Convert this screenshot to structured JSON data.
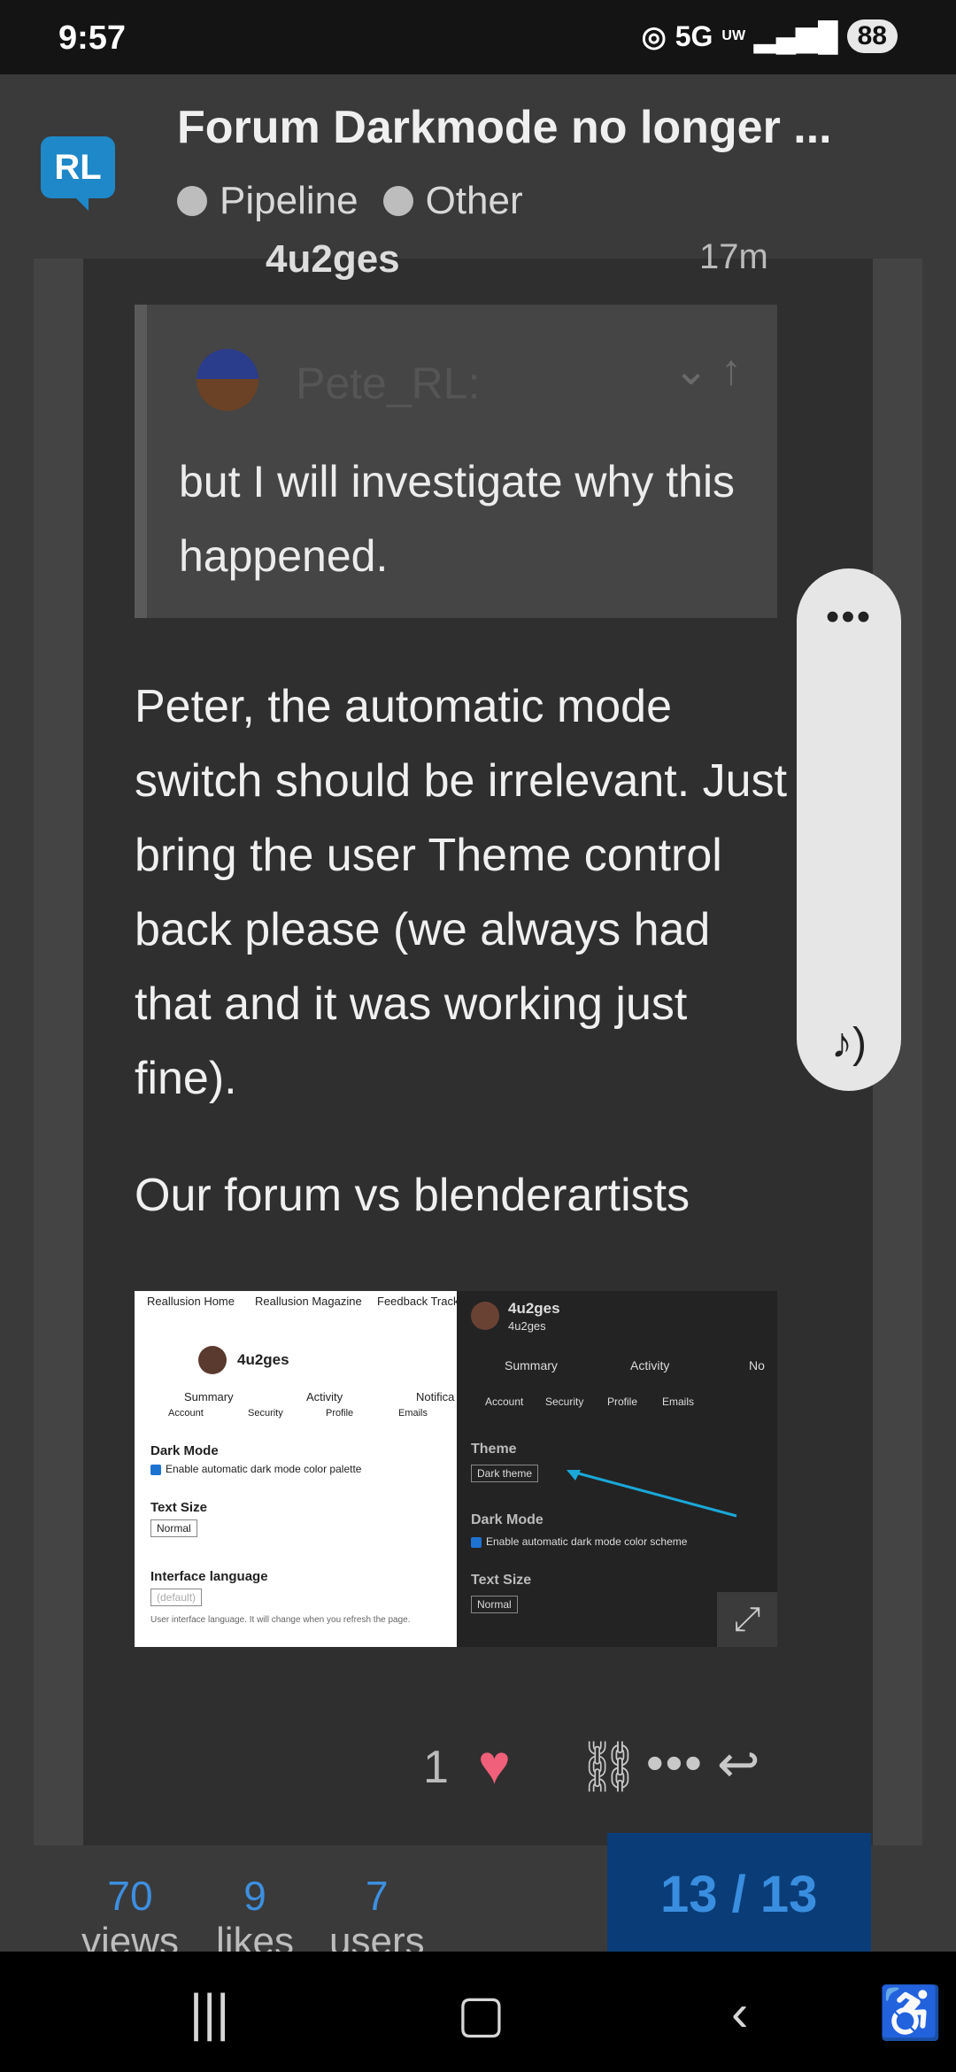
{
  "status_bar": {
    "time": "9:57",
    "network": "5G",
    "network_sub": "UW",
    "battery": "88"
  },
  "header": {
    "logo_text": "RL",
    "title": "Forum Darkmode no longer ...",
    "categories": [
      "Pipeline",
      "Other"
    ]
  },
  "post": {
    "username_partial": "4u2ges",
    "time_partial": "17m",
    "quote": {
      "author": "Pete_RL:",
      "text": "but I will investigate why this happened."
    },
    "body": "Peter, the automatic mode switch should be irrelevant. Just bring the user Theme control back please (we always had that and it was working just fine).",
    "body2": "Our forum vs blenderartists",
    "image": {
      "light": {
        "nav": [
          "Reallusion Home",
          "Reallusion Magazine",
          "Feedback Track"
        ],
        "user": "4u2ges",
        "tabs1": [
          "Summary",
          "Activity",
          "Notifica"
        ],
        "tabs2": [
          "Account",
          "Security",
          "Profile",
          "Emails"
        ],
        "dark_mode_label": "Dark Mode",
        "dark_mode_check": "Enable automatic dark mode color palette",
        "text_size_label": "Text Size",
        "text_size_value": "Normal",
        "lang_label": "Interface language",
        "lang_value": "(default)",
        "lang_help": "User interface language. It will change when you refresh the page."
      },
      "dark": {
        "user": "4u2ges",
        "user_sub": "4u2ges",
        "tabs1": [
          "Summary",
          "Activity",
          "No"
        ],
        "tabs2": [
          "Account",
          "Security",
          "Profile",
          "Emails"
        ],
        "theme_label": "Theme",
        "theme_value": "Dark theme",
        "dark_mode_label": "Dark Mode",
        "dark_mode_check": "Enable automatic dark mode color scheme",
        "text_size_label": "Text Size",
        "text_size_value": "Normal",
        "arrow_color": "#1aa8d8"
      }
    },
    "likes": "1",
    "heart_color": "#f0607a"
  },
  "stats": [
    {
      "num": "70",
      "label": "views"
    },
    {
      "num": "9",
      "label": "likes"
    },
    {
      "num": "7",
      "label": "users"
    }
  ],
  "progress": "13 / 13",
  "accent": "#3d8fe0"
}
